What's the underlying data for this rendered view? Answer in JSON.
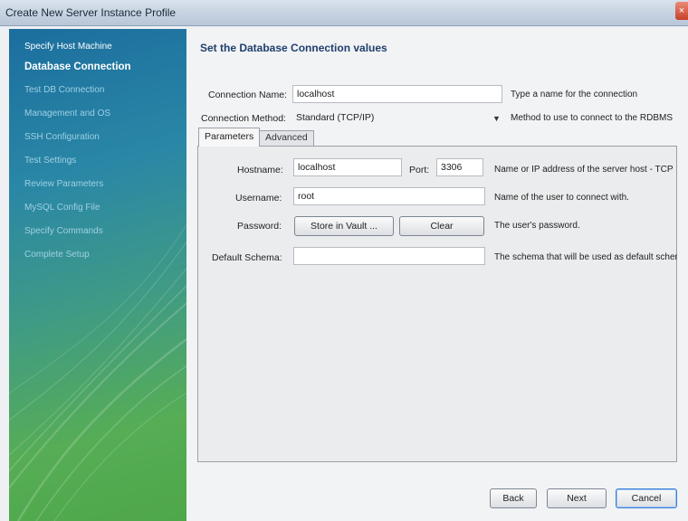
{
  "window": {
    "title": "Create New Server Instance Profile"
  },
  "sidebar": {
    "items": [
      {
        "label": "Specify Host Machine",
        "state": "done"
      },
      {
        "label": "Database Connection",
        "state": "active"
      },
      {
        "label": "Test DB Connection",
        "state": "pending"
      },
      {
        "label": "Management and OS",
        "state": "pending"
      },
      {
        "label": "SSH Configuration",
        "state": "pending"
      },
      {
        "label": "Test Settings",
        "state": "pending"
      },
      {
        "label": "Review Parameters",
        "state": "pending"
      },
      {
        "label": "MySQL Config File",
        "state": "pending"
      },
      {
        "label": "Specify Commands",
        "state": "pending"
      },
      {
        "label": "Complete Setup",
        "state": "pending"
      }
    ]
  },
  "main": {
    "heading": "Set the Database Connection values",
    "connection_name": {
      "label": "Connection Name:",
      "value": "localhost",
      "hint": "Type a name for the connection"
    },
    "connection_method": {
      "label": "Connection Method:",
      "value": "Standard (TCP/IP)",
      "hint": "Method to use to connect to the RDBMS"
    },
    "tabs": [
      {
        "label": "Parameters",
        "active": true
      },
      {
        "label": "Advanced",
        "active": false
      }
    ],
    "parameters": {
      "hostname": {
        "label": "Hostname:",
        "value": "localhost",
        "hint": "Name or IP address of the server host - TCP"
      },
      "port": {
        "label": "Port:",
        "value": "3306"
      },
      "username": {
        "label": "Username:",
        "value": "root",
        "hint": "Name of the user to connect with."
      },
      "password": {
        "label": "Password:",
        "store_label": "Store in Vault ...",
        "clear_label": "Clear",
        "hint": "The user's password."
      },
      "default_schema": {
        "label": "Default Schema:",
        "value": "",
        "hint": "The schema that will be used as default schema"
      }
    }
  },
  "footer": {
    "back_label": "Back",
    "next_label": "Next",
    "cancel_label": "Cancel"
  },
  "colors": {
    "sidebar_top": "#1b6e9e",
    "sidebar_bottom": "#4ea748",
    "heading": "#1f3f6e"
  }
}
